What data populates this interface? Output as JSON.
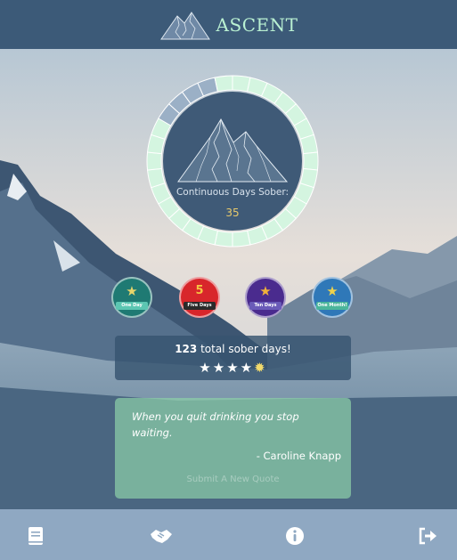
{
  "header": {
    "brand": "ASCENT"
  },
  "counter": {
    "label": "Continuous Days Sober:",
    "value": "35"
  },
  "badges": [
    {
      "label": "One Day",
      "color": "#1f7a73",
      "ribbon": "#5cc6b2"
    },
    {
      "label": "Five Days",
      "color": "#d8262b",
      "ribbon": "#2a2a2a",
      "number": "5"
    },
    {
      "label": "Ten Days",
      "color": "#4a2b8e",
      "ribbon": "#6a5bb8"
    },
    {
      "label": "One Month!",
      "color": "#2f78b8",
      "ribbon": "#4bb59b"
    }
  ],
  "stats": {
    "total": "123",
    "text": " total sober days!",
    "rating_full": 4,
    "rating_extra": "sun-icon"
  },
  "quote": {
    "text": "When you quit drinking you stop waiting.",
    "author": "- Caroline Knapp",
    "submit_label": "Submit A New Quote"
  },
  "footer": {
    "icons": [
      "journal-icon",
      "handshake-icon",
      "info-icon",
      "logout-icon"
    ]
  },
  "colors": {
    "header": "#3c5a78",
    "accent": "#b9f0d2",
    "ring_filled": "#d4f5e0",
    "ring_empty": "#9bb0c6"
  }
}
